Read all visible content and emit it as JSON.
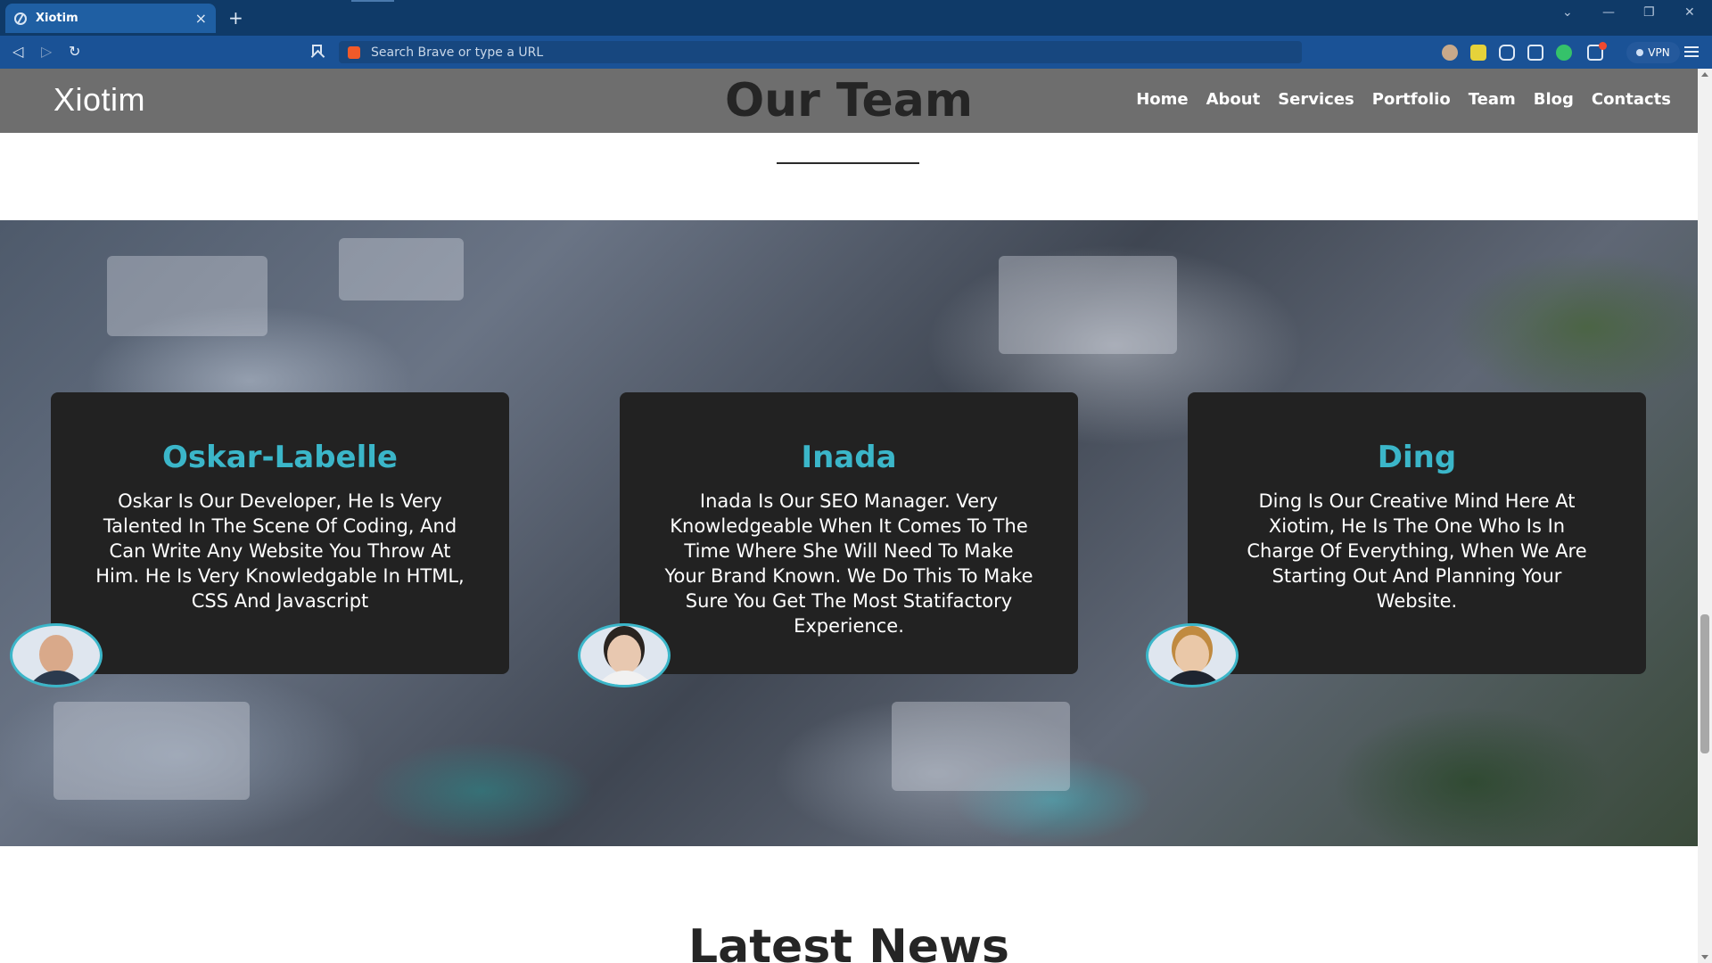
{
  "browser": {
    "tab_title": "Xiotim",
    "tab_close_symbol": "×",
    "new_tab_symbol": "+",
    "address_placeholder": "Search Brave or type a URL",
    "vpn_label": "VPN",
    "window_controls": [
      "⌄",
      "—",
      "❐",
      "✕"
    ],
    "nav_symbols": {
      "back": "◁",
      "forward": "▷",
      "reload": "↻"
    }
  },
  "site": {
    "logo": "Xiotim",
    "nav": [
      "Home",
      "About",
      "Services",
      "Portfolio",
      "Team",
      "Blog",
      "Contacts"
    ],
    "section_title": "Our Team",
    "next_section_title": "Latest News"
  },
  "team": [
    {
      "name": "Oskar-Labelle",
      "bio": "Oskar Is Our Developer, He Is Very Talented In The Scene Of Coding, And Can Write Any Website You Throw At Him. He Is Very Knowledgable In HTML, CSS And Javascript"
    },
    {
      "name": "Inada",
      "bio": "Inada Is Our SEO Manager. Very Knowledgeable When It Comes To The Time Where She Will Need To Make Your Brand Known. We Do This To Make Sure You Get The Most Statifactory Experience."
    },
    {
      "name": "Ding",
      "bio": "Ding Is Our Creative Mind Here At Xiotim, He Is The One Who Is In Charge Of Everything, When We Are Starting Out And Planning Your Website."
    }
  ],
  "colors": {
    "accent": "#3bb6c9",
    "header_bg": "#6e6e6e",
    "card_bg": "#222222",
    "browser_bg": "#1a5296"
  }
}
